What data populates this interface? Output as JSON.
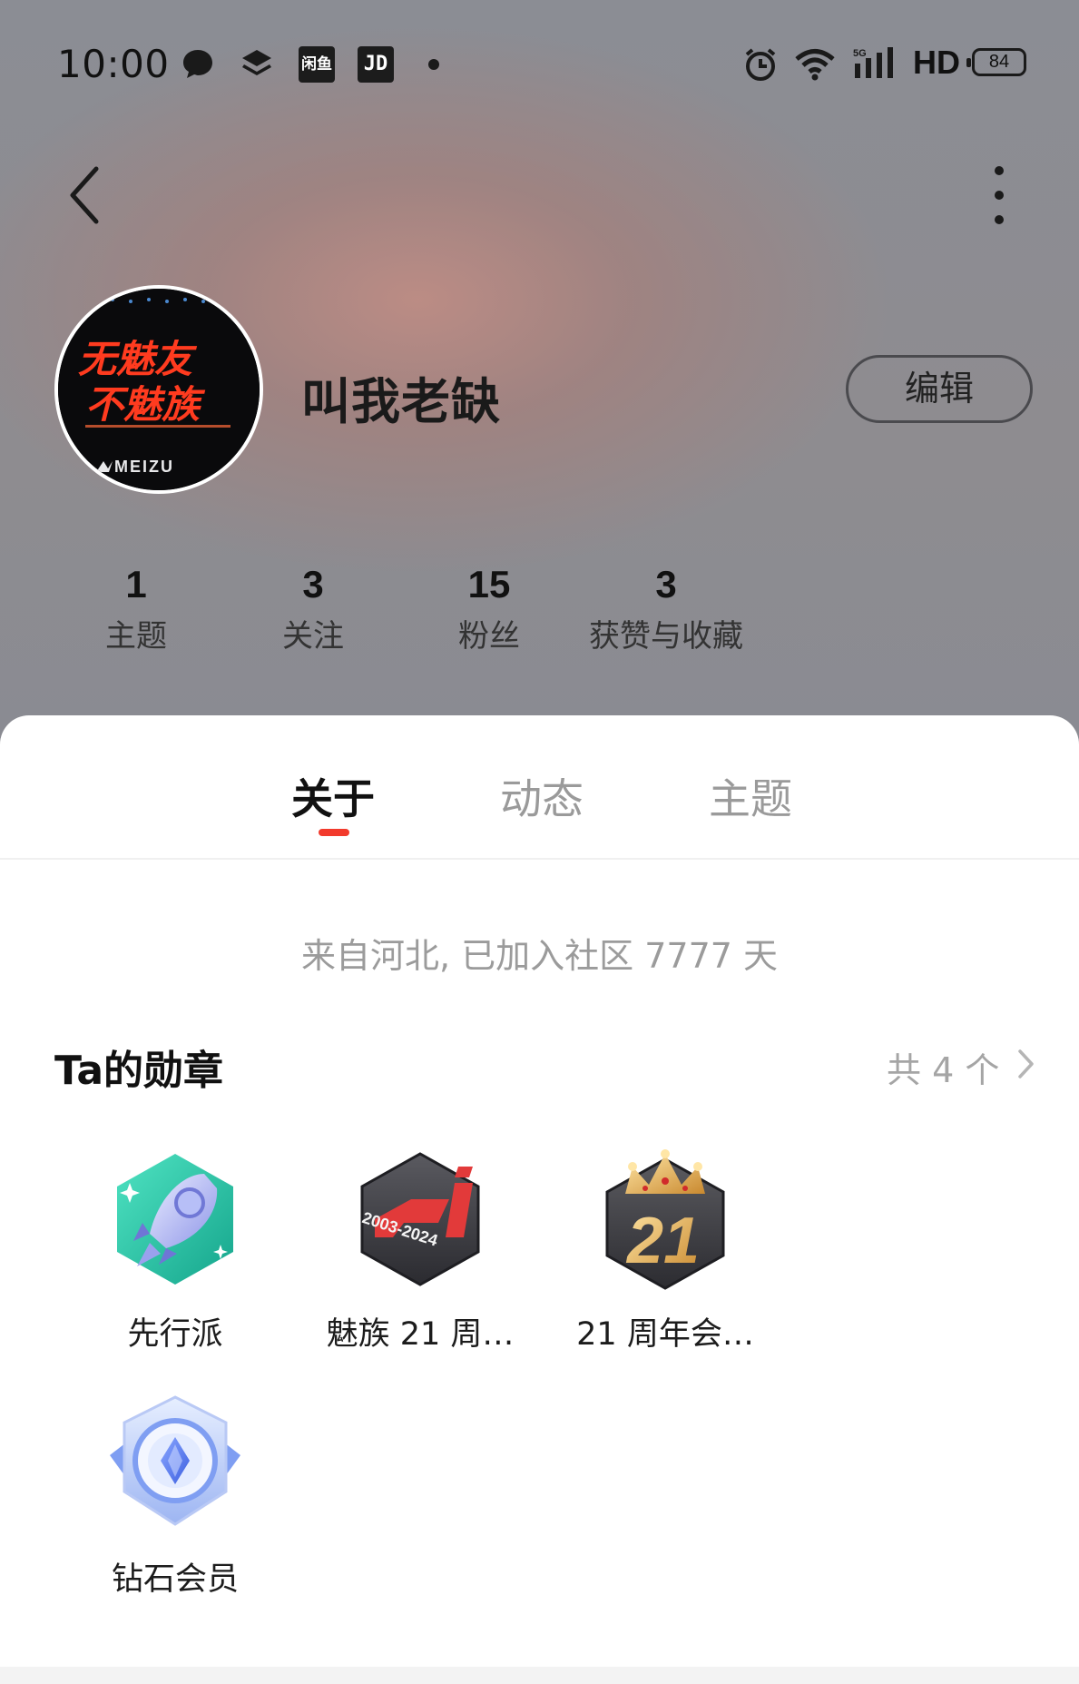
{
  "status_bar": {
    "time": "10:00",
    "icons": [
      "chat-bubble-icon",
      "layers-icon",
      "xianyu-app-icon",
      "jd-app-icon",
      "dot-icon",
      "alarm-icon",
      "wifi-icon",
      "signal-5g-icon"
    ],
    "xianyu_label": "闲鱼",
    "jd_label": "JD",
    "hd_label": "HD",
    "battery_level": "84"
  },
  "header": {
    "back_icon": "chevron-left-icon",
    "more_icon": "more-vertical-icon"
  },
  "profile": {
    "username": "叫我老缺",
    "edit_label": "编辑",
    "avatar_text_line1": "无魅友",
    "avatar_text_line2": "不魅族",
    "avatar_brand": "MEIZU"
  },
  "stats": [
    {
      "value": "1",
      "label": "主题"
    },
    {
      "value": "3",
      "label": "关注"
    },
    {
      "value": "15",
      "label": "粉丝"
    },
    {
      "value": "3",
      "label": "获赞与收藏"
    }
  ],
  "tabs": [
    {
      "label": "关于",
      "active": true
    },
    {
      "label": "动态",
      "active": false
    },
    {
      "label": "主题",
      "active": false
    }
  ],
  "accent_color": "#f23a2c",
  "about": {
    "intro": "来自河北, 已加入社区 7777 天"
  },
  "badges_section": {
    "title": "Ta的勋章",
    "count_label": "共 4 个",
    "items": [
      {
        "name": "先行派",
        "icon": "rocket-badge-icon"
      },
      {
        "name": "魅族 21 周…",
        "icon": "meizu-21-anniversary-badge-icon",
        "years": "2003-2024"
      },
      {
        "name": "21 周年会…",
        "icon": "crown-21-badge-icon",
        "number": "21"
      },
      {
        "name": "钻石会员",
        "icon": "diamond-member-badge-icon"
      }
    ]
  }
}
